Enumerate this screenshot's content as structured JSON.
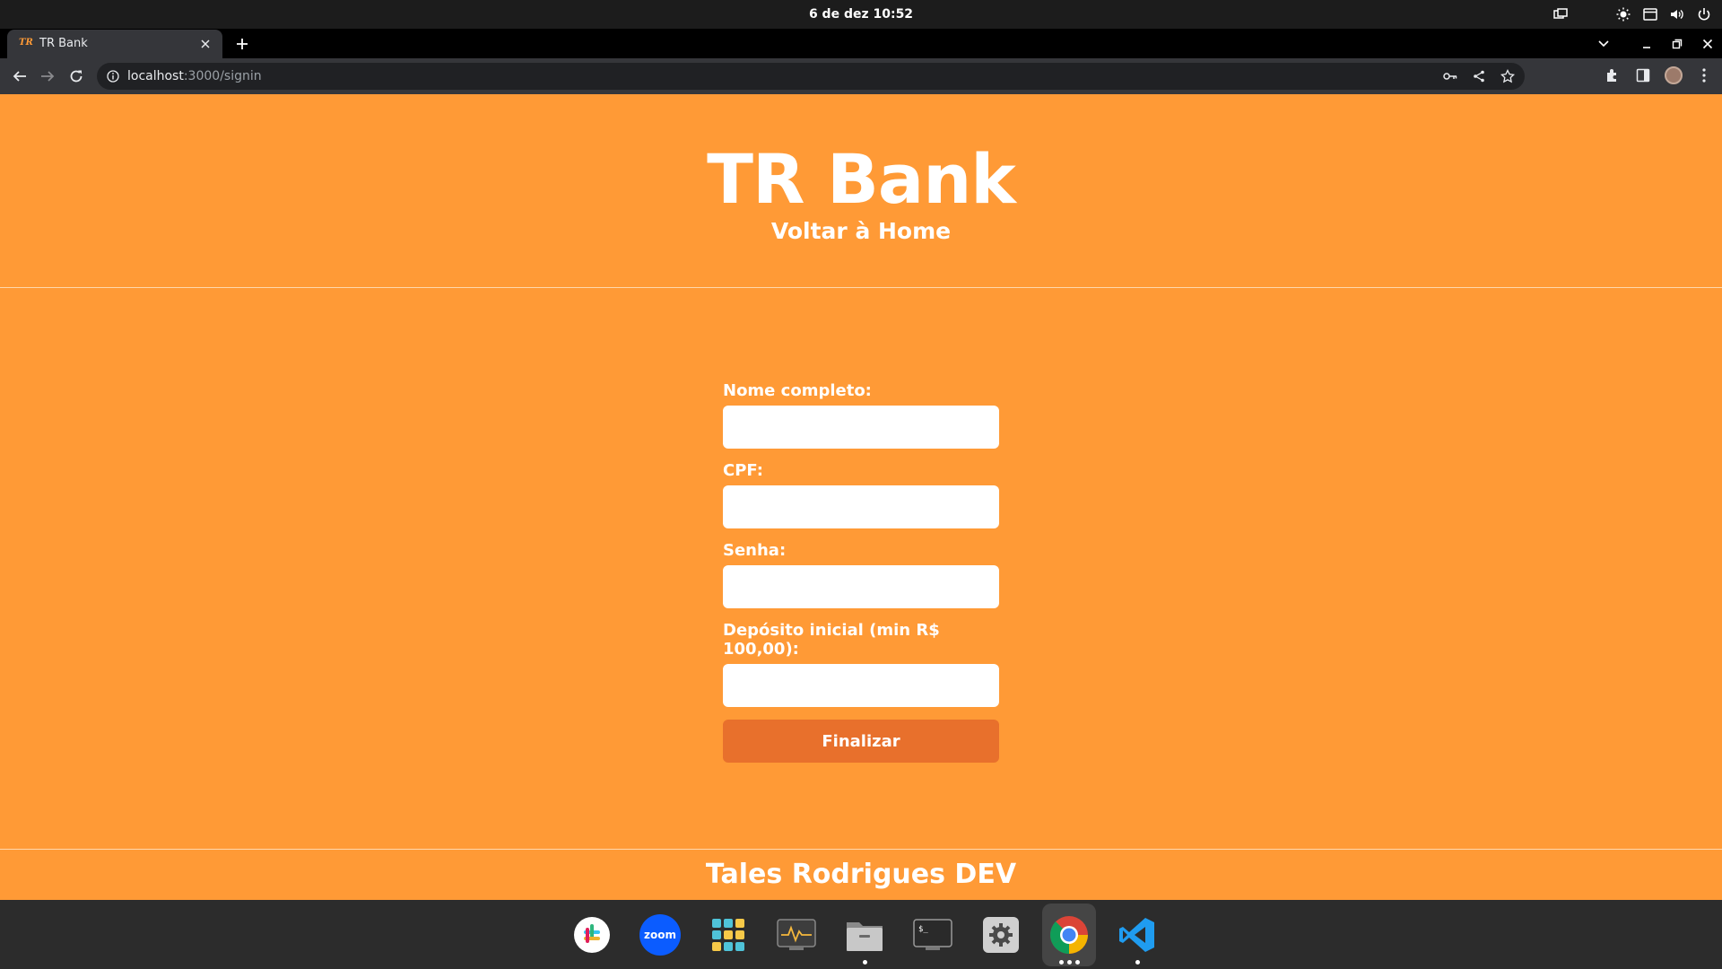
{
  "system_bar": {
    "clock": "6 de dez  10:52"
  },
  "browser": {
    "tab_title": "TR Bank",
    "tab_favicon_text": "TR",
    "url_host": "localhost",
    "url_path": ":3000/signin"
  },
  "page": {
    "brand": "TR Bank",
    "home_link": "Voltar à Home",
    "form": {
      "name_label": "Nome completo:",
      "cpf_label": "CPF:",
      "password_label": "Senha:",
      "deposit_label": "Depósito inicial (min R$ 100,00):",
      "submit_label": "Finalizar"
    },
    "footer": "Tales Rodrigues DEV",
    "colors": {
      "background": "#ff9a36",
      "button": "#e8702c",
      "text": "#ffffff"
    }
  },
  "dock": {
    "apps": [
      {
        "name": "slack-icon",
        "running": false
      },
      {
        "name": "zoom-icon",
        "label": "zoom",
        "running": false
      },
      {
        "name": "app-grid-icon",
        "running": false
      },
      {
        "name": "system-monitor-icon",
        "running": false
      },
      {
        "name": "files-icon",
        "running": true
      },
      {
        "name": "terminal-icon",
        "label": "$_",
        "running": false
      },
      {
        "name": "settings-icon",
        "running": false
      },
      {
        "name": "chrome-icon",
        "running": true
      },
      {
        "name": "vscode-icon",
        "running": true
      }
    ]
  }
}
